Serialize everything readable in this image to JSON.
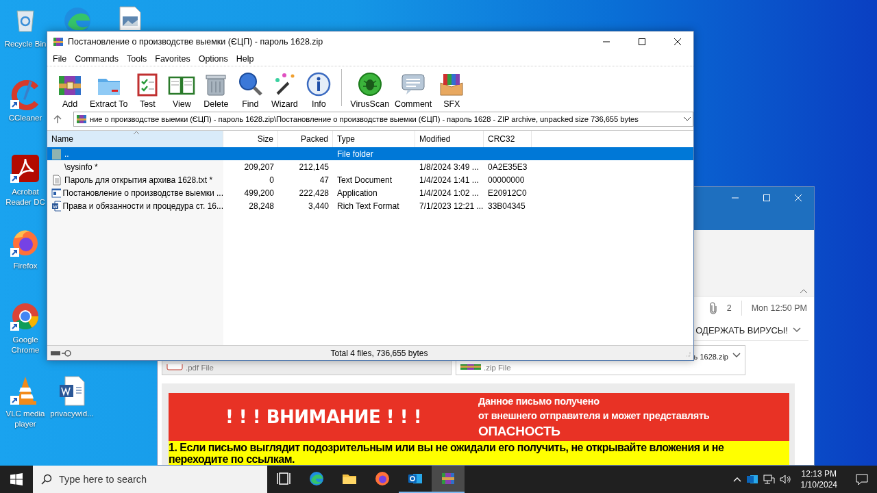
{
  "desktop_icons": [
    {
      "kind": "recycle",
      "label": "Recycle Bin",
      "shortcut": false
    },
    {
      "kind": "edge",
      "shortcut": false
    },
    {
      "kind": "image",
      "shortcut": false
    },
    {
      "kind": "ccleaner",
      "label": "CCleaner",
      "shortcut": true
    },
    {
      "kind": "acrobat",
      "label": "Acrobat Reader DC",
      "shortcut": true
    },
    {
      "kind": "firefox",
      "label": "Firefox",
      "shortcut": true
    },
    {
      "kind": "chrome",
      "label": "Google Chrome",
      "shortcut": true
    },
    {
      "kind": "vlc",
      "label": "VLC media player",
      "shortcut": true
    },
    {
      "kind": "word",
      "label": "privacywid...",
      "shortcut": false
    }
  ],
  "email": {
    "attachment_count": "2",
    "date": "Mon 12:50 PM",
    "subject": "ОДЕРЖАТЬ ВИРУСЫ!",
    "attachments": [
      {
        "kind": "pdf",
        "type": ".pdf File"
      },
      {
        "kind": "zip",
        "name": "ь 1628.zip",
        "type": ".zip File"
      }
    ],
    "banner": {
      "title": "! ! ! ВНИМАНИЕ ! ! !",
      "notice_lines": [
        "Данное письмо получено",
        "от внешнего отправителя и может представлять"
      ],
      "notice_emphasis": "ОПАСНОСТЬ"
    },
    "warnings": [
      "1. Если письмо выглядит подозрительным или вы не ожидали его получить, не открывайте вложения и не переходите по ссылкам."
    ]
  },
  "winrar": {
    "title": "Постановление о производстве выемки (ЄЦП) - пароль 1628.zip",
    "menu": [
      "File",
      "Commands",
      "Tools",
      "Favorites",
      "Options",
      "Help"
    ],
    "toolbar_groups": [
      [
        {
          "kind": "add",
          "label": "Add"
        },
        {
          "kind": "extract",
          "label": "Extract To"
        },
        {
          "kind": "test",
          "label": "Test"
        },
        {
          "kind": "view",
          "label": "View"
        },
        {
          "kind": "delete",
          "label": "Delete"
        },
        {
          "kind": "find",
          "label": "Find"
        },
        {
          "kind": "wizard",
          "label": "Wizard"
        },
        {
          "kind": "info",
          "label": "Info"
        }
      ],
      [
        {
          "kind": "virusscan",
          "label": "VirusScan"
        },
        {
          "kind": "comment",
          "label": "Comment"
        },
        {
          "kind": "sfx",
          "label": "SFX"
        }
      ]
    ],
    "path": "ние о производстве выемки (ЄЦП) - пароль 1628.zip\\Постановление о производстве выемки (ЄЦП) - пароль 1628 - ZIP archive, unpacked size 736,655 bytes",
    "columns": [
      "Name",
      "Size",
      "Packed",
      "Type",
      "Modified",
      "CRC32"
    ],
    "rows": [
      {
        "kind": "folder",
        "name": "..",
        "size": "",
        "packed": "",
        "type": "File folder",
        "modified": "",
        "crc": "",
        "selected": true
      },
      {
        "kind": "none",
        "name": "\\sysinfo *",
        "size": "209,207",
        "packed": "212,145",
        "type": "",
        "modified": "1/8/2024 3:49 ...",
        "crc": "0A2E35E3",
        "selected": false
      },
      {
        "kind": "text",
        "name": "Пароль для открытия архива 1628.txt *",
        "size": "0",
        "packed": "47",
        "type": "Text Document",
        "modified": "1/4/2024 1:41 ...",
        "crc": "00000000",
        "selected": false
      },
      {
        "kind": "app",
        "name": "Постановление о производстве выемки ...",
        "size": "499,200",
        "packed": "222,428",
        "type": "Application",
        "modified": "1/4/2024 1:02 ...",
        "crc": "E20912C0",
        "selected": false
      },
      {
        "kind": "word",
        "name": "Права и обязанности и процедура ст. 16...",
        "size": "28,248",
        "packed": "3,440",
        "type": "Rich Text Format",
        "modified": "7/1/2023 12:21 ...",
        "crc": "33B04345",
        "selected": false
      }
    ],
    "status": "Total 4 files, 736,655 bytes"
  },
  "taskbar": {
    "search_placeholder": "Type here to search",
    "apps": [
      {
        "kind": "taskview",
        "running": false,
        "selected": false
      },
      {
        "kind": "edge",
        "running": false,
        "selected": false
      },
      {
        "kind": "explorer",
        "running": false,
        "selected": false
      },
      {
        "kind": "firefox",
        "running": false,
        "selected": false
      },
      {
        "kind": "outlook",
        "running": true,
        "selected": false
      },
      {
        "kind": "winrar",
        "running": true,
        "selected": true
      }
    ],
    "time": "12:13 PM",
    "date": "1/10/2024"
  }
}
